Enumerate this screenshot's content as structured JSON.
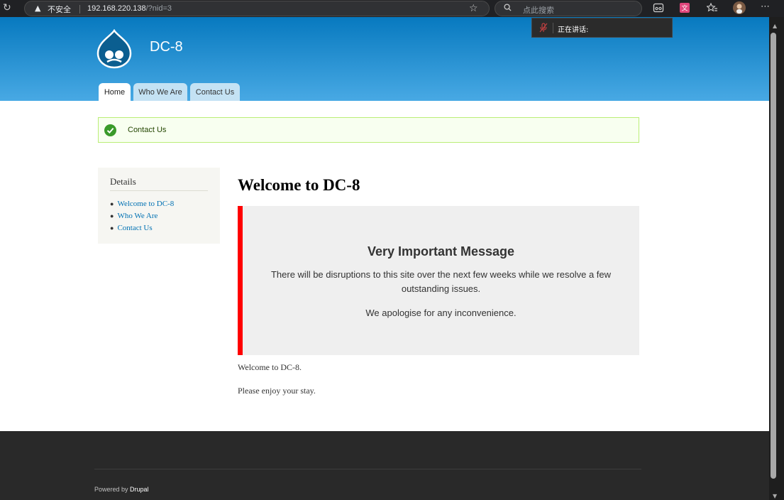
{
  "browser": {
    "security_label": "不安全",
    "url_host": "192.168.220.138",
    "url_path": "/?nid=3",
    "search_placeholder": "点此搜索",
    "voice_status": "正在讲话:"
  },
  "site": {
    "name": "DC-8",
    "brand_color": "#0779bf"
  },
  "nav": {
    "tabs": [
      {
        "label": "Home",
        "active": true
      },
      {
        "label": "Who We Are",
        "active": false
      },
      {
        "label": "Contact Us",
        "active": false
      }
    ]
  },
  "status": {
    "message": "Contact Us",
    "icon": "check-circle-icon",
    "color": "#3a9a2a"
  },
  "sidebar": {
    "title": "Details",
    "links": [
      {
        "label": "Welcome to DC-8"
      },
      {
        "label": "Who We Are"
      },
      {
        "label": "Contact Us"
      }
    ]
  },
  "main": {
    "title": "Welcome to DC-8",
    "notice": {
      "heading": "Very Important Message",
      "body": "There will be disruptions to this site over the next few weeks while we resolve a few outstanding issues.",
      "apology": "We apologise for any inconvenience.",
      "accent_color": "#ff0000"
    },
    "paragraphs": [
      "Welcome to DC-8.",
      "Please enjoy your stay."
    ]
  },
  "footer": {
    "powered_prefix": "Powered by",
    "powered_link": "Drupal"
  }
}
